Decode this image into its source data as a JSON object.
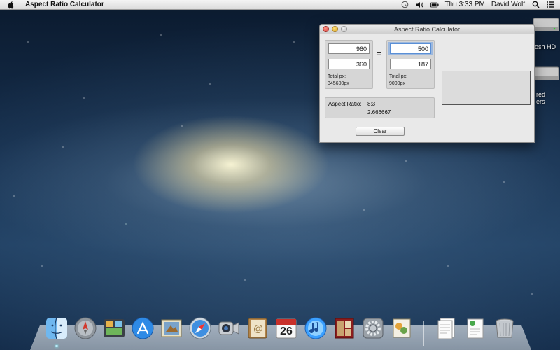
{
  "menubar": {
    "app_name": "Aspect Ratio Calculator",
    "clock": "Thu 3:33 PM",
    "user": "David Wolf"
  },
  "desktop": {
    "drive1_label": "osh HD",
    "drive2_label_line1": "red",
    "drive2_label_line2": "ers"
  },
  "window": {
    "title": "Aspect Ratio Calculator",
    "left": {
      "width": "960",
      "height": "360",
      "total_label": "Total px:",
      "total_value": "345600px"
    },
    "equals": "=",
    "right": {
      "width": "500",
      "height": "187",
      "total_label": "Total px:",
      "total_value": "9000px"
    },
    "aspect": {
      "label": "Aspect Ratio:",
      "ratio": "8:3",
      "decimal": "2.666667"
    },
    "clear_label": "Clear"
  },
  "dock": {
    "calendar_day": "26",
    "items": [
      "finder",
      "launchpad",
      "mission-control",
      "app-store",
      "mail",
      "safari",
      "facetime",
      "contacts",
      "calendar",
      "itunes",
      "photo-booth",
      "system-preferences",
      "preview",
      "documents",
      "downloads",
      "trash"
    ]
  }
}
